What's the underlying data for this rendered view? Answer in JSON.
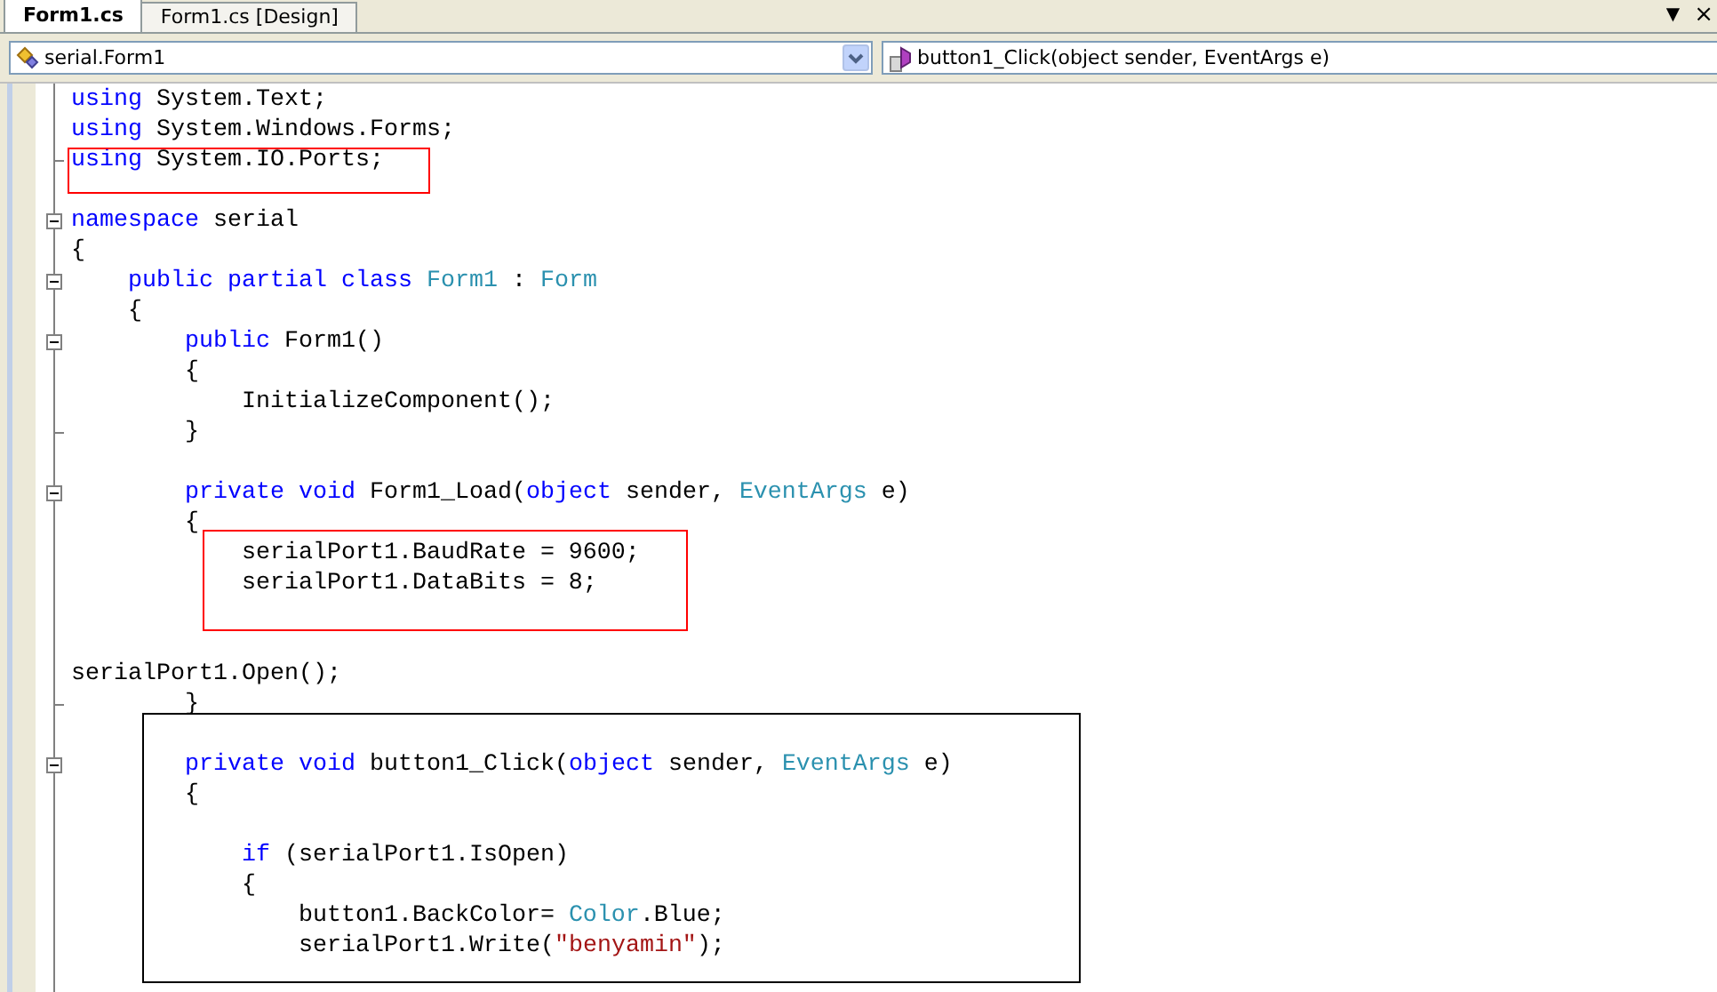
{
  "tabs": [
    {
      "label": "Form1.cs",
      "selected": true
    },
    {
      "label": "Form1.cs [Design]",
      "selected": false
    }
  ],
  "tab_controls": {
    "dropdown": "▼",
    "close": "×"
  },
  "navigation": {
    "type_combo": "serial.Form1",
    "member_combo": "button1_Click(object sender, EventArgs e)"
  },
  "editor": {
    "lines": [
      {
        "kind": "text",
        "tokens": [
          {
            "text": "using",
            "kind": "keyword"
          },
          {
            "text": " System.Text;",
            "kind": "plain"
          }
        ]
      },
      {
        "kind": "text",
        "tokens": [
          {
            "text": "using",
            "kind": "keyword"
          },
          {
            "text": " System.Windows.Forms;",
            "kind": "plain"
          }
        ]
      },
      {
        "kind": "end",
        "tokens": [
          {
            "text": "using",
            "kind": "keyword"
          },
          {
            "text": " System.IO.Ports;",
            "kind": "plain"
          }
        ]
      },
      {
        "kind": "blank"
      },
      {
        "kind": "block",
        "tokens": [
          {
            "text": "namespace",
            "kind": "keyword"
          },
          {
            "text": " serial",
            "kind": "plain"
          }
        ]
      },
      {
        "kind": "text",
        "tokens": [
          {
            "text": "{",
            "kind": "plain"
          }
        ]
      },
      {
        "kind": "block",
        "tokens": [
          {
            "text": "    public partial class",
            "kind": "keyword"
          },
          {
            "text": " Form1",
            "kind": "type"
          },
          {
            "text": " : ",
            "kind": "plain"
          },
          {
            "text": "Form",
            "kind": "type"
          }
        ]
      },
      {
        "kind": "text",
        "tokens": [
          {
            "text": "    {",
            "kind": "plain"
          }
        ]
      },
      {
        "kind": "block",
        "tokens": [
          {
            "text": "        public",
            "kind": "keyword"
          },
          {
            "text": " Form1()",
            "kind": "plain"
          }
        ]
      },
      {
        "kind": "text",
        "tokens": [
          {
            "text": "        {",
            "kind": "plain"
          }
        ]
      },
      {
        "kind": "text",
        "tokens": [
          {
            "text": "            InitializeComponent();",
            "kind": "plain"
          }
        ]
      },
      {
        "kind": "end",
        "tokens": [
          {
            "text": "        }",
            "kind": "plain"
          }
        ]
      },
      {
        "kind": "blank"
      },
      {
        "kind": "block",
        "tokens": [
          {
            "text": "        private void",
            "kind": "keyword"
          },
          {
            "text": " Form1_Load(",
            "kind": "plain"
          },
          {
            "text": "object",
            "kind": "keyword"
          },
          {
            "text": " sender, ",
            "kind": "plain"
          },
          {
            "text": "EventArgs",
            "kind": "type"
          },
          {
            "text": " e)",
            "kind": "plain"
          }
        ]
      },
      {
        "kind": "text",
        "tokens": [
          {
            "text": "        {",
            "kind": "plain"
          }
        ]
      },
      {
        "kind": "text",
        "tokens": [
          {
            "text": "            serialPort1.BaudRate = 9600;",
            "kind": "plain"
          }
        ]
      },
      {
        "kind": "text",
        "tokens": [
          {
            "text": "            serialPort1.DataBits = 8;",
            "kind": "plain"
          }
        ]
      },
      {
        "kind": "blank"
      },
      {
        "kind": "blank"
      },
      {
        "kind": "text",
        "tokens": [
          {
            "text": "serialPort1.Open();",
            "kind": "plain"
          }
        ]
      },
      {
        "kind": "end",
        "tokens": [
          {
            "text": "        }",
            "kind": "plain"
          }
        ]
      },
      {
        "kind": "blank"
      },
      {
        "kind": "block",
        "tokens": [
          {
            "text": "        private void",
            "kind": "keyword"
          },
          {
            "text": " button1_Click(",
            "kind": "plain"
          },
          {
            "text": "object",
            "kind": "keyword"
          },
          {
            "text": " sender, ",
            "kind": "plain"
          },
          {
            "text": "EventArgs",
            "kind": "type"
          },
          {
            "text": " e)",
            "kind": "plain"
          }
        ]
      },
      {
        "kind": "text",
        "tokens": [
          {
            "text": "        {",
            "kind": "plain"
          }
        ]
      },
      {
        "kind": "blank"
      },
      {
        "kind": "text",
        "tokens": [
          {
            "text": "            if",
            "kind": "keyword"
          },
          {
            "text": " (serialPort1.IsOpen)",
            "kind": "plain"
          }
        ]
      },
      {
        "kind": "text",
        "tokens": [
          {
            "text": "            {",
            "kind": "plain"
          }
        ]
      },
      {
        "kind": "text",
        "tokens": [
          {
            "text": "                button1.BackColor= ",
            "kind": "plain"
          },
          {
            "text": "Color",
            "kind": "type"
          },
          {
            "text": ".Blue;",
            "kind": "plain"
          }
        ]
      },
      {
        "kind": "text",
        "tokens": [
          {
            "text": "                serialPort1.Write(",
            "kind": "plain"
          },
          {
            "text": "\"benyamin\"",
            "kind": "string"
          },
          {
            "text": ");",
            "kind": "plain"
          }
        ]
      }
    ]
  }
}
